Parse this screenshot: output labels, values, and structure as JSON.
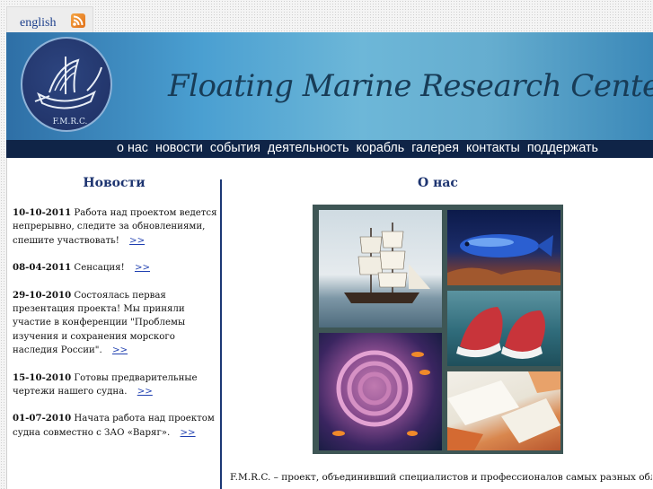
{
  "lang": {
    "label": "english"
  },
  "header": {
    "title": "Floating Marine Research Center",
    "logo_caption": "F.M.R.C."
  },
  "nav": {
    "items": [
      "о нас",
      "новости",
      "события",
      "деятельность",
      "корабль",
      "галерея",
      "контакты",
      "поддержать"
    ]
  },
  "news": {
    "title": "Новости",
    "more_label": ">>",
    "items": [
      {
        "date": "10-10-2011",
        "text": "Работа над проектом ведется непрерывно, следите за обновлениями, спешите участвовать!"
      },
      {
        "date": "08-04-2011",
        "text": "Сенсация!"
      },
      {
        "date": "29-10-2010",
        "text": "Состоялась первая презентация проекта! Мы приняли участие в конференции \"Проблемы изучения и сохранения морского наследия России\"."
      },
      {
        "date": "15-10-2010",
        "text": "Готовы предварительные чертежи нашего судна."
      },
      {
        "date": "01-07-2010",
        "text": "Начата работа над проектом судна совместно с ЗАО «Варяг»."
      }
    ]
  },
  "about": {
    "title": "О нас",
    "text": "F.M.R.C. – проект, объединивший специалистов и профессионалов самых разных областей –"
  },
  "icons": {
    "rss": "rss-icon",
    "logo": "ship-logo-icon"
  }
}
